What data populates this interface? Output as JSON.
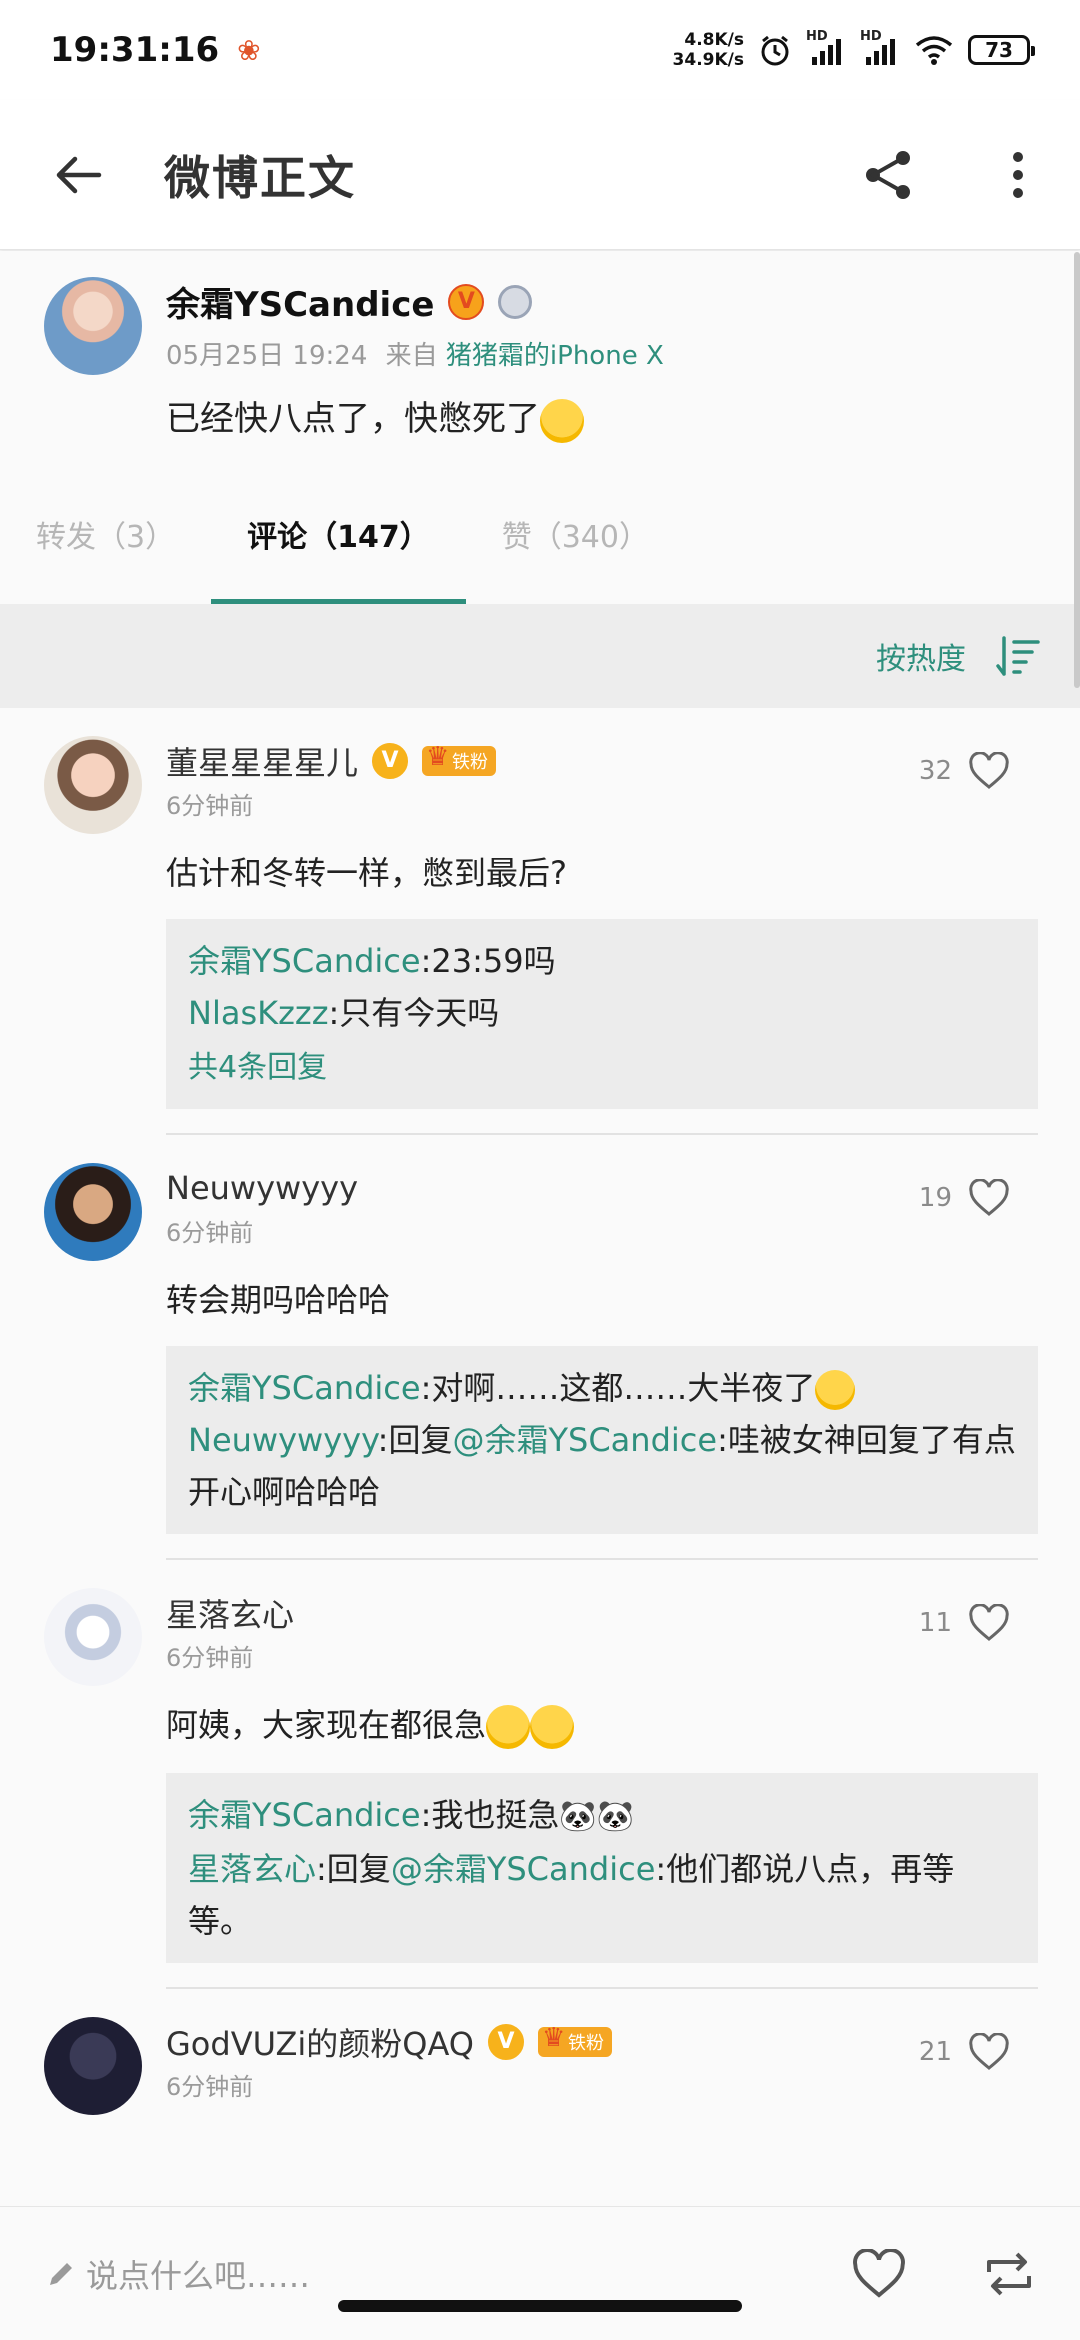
{
  "status_bar": {
    "time": "19:31:16",
    "net_up": "4.8K/s",
    "net_down": "34.9K/s",
    "signal1_label": "HD",
    "signal2_label": "HD",
    "battery": "73"
  },
  "toolbar": {
    "title": "微博正文"
  },
  "post": {
    "author": "余霜YSCandice",
    "date": "05月25日 19:24",
    "source_prefix": "来自",
    "source": "猪猪霜的iPhone X",
    "text": "已经快八点了，快憋死了"
  },
  "tabs": [
    {
      "label": "转发（3）"
    },
    {
      "label": "评论（147）"
    },
    {
      "label": "赞（340）"
    }
  ],
  "sort": {
    "label": "按热度"
  },
  "comments": [
    {
      "name": "董星星星星儿",
      "fan_badge": "铁粉",
      "time": "6分钟前",
      "likes": "32",
      "text": "估计和冬转一样，憋到最后?",
      "replies": [
        {
          "user": "余霜YSCandice",
          "text": ":23:59吗"
        },
        {
          "user": "NlasKzzz",
          "text": ":只有今天吗"
        }
      ],
      "more": "共4条回复"
    },
    {
      "name": "Neuwywyyy",
      "time": "6分钟前",
      "likes": "19",
      "text": "转会期吗哈哈哈",
      "replies": [
        {
          "user": "余霜YSCandice",
          "text": ":对啊……这都……大半夜了"
        },
        {
          "user": "Neuwywyyy",
          "text": ":回复",
          "mention": "@余霜YSCandice",
          "text2": ":哇被女神回复了有点开心啊哈哈哈"
        }
      ]
    },
    {
      "name": "星落玄心",
      "time": "6分钟前",
      "likes": "11",
      "text": "阿姨，大家现在都很急",
      "replies": [
        {
          "user": "余霜YSCandice",
          "text": ":我也挺急"
        },
        {
          "user": "星落玄心",
          "text": ":回复",
          "mention": "@余霜YSCandice",
          "text2": ":他们都说八点，再等等。"
        }
      ]
    },
    {
      "name": "GodVUZi的颜粉QAQ",
      "fan_badge": "铁粉",
      "time": "6分钟前",
      "likes": "21"
    }
  ],
  "bottom_bar": {
    "input_placeholder": "说点什么吧……"
  },
  "colors": {
    "accent": "#2e8f7d",
    "verified": "#f7a21b",
    "fan_badge": "#f5a623"
  },
  "icons": [
    "back-arrow-icon",
    "share-icon",
    "more-vert-icon",
    "sort-icon",
    "heart-icon",
    "pencil-icon",
    "repost-icon",
    "alarm-icon",
    "wifi-icon",
    "signal-icon",
    "battery-icon"
  ]
}
